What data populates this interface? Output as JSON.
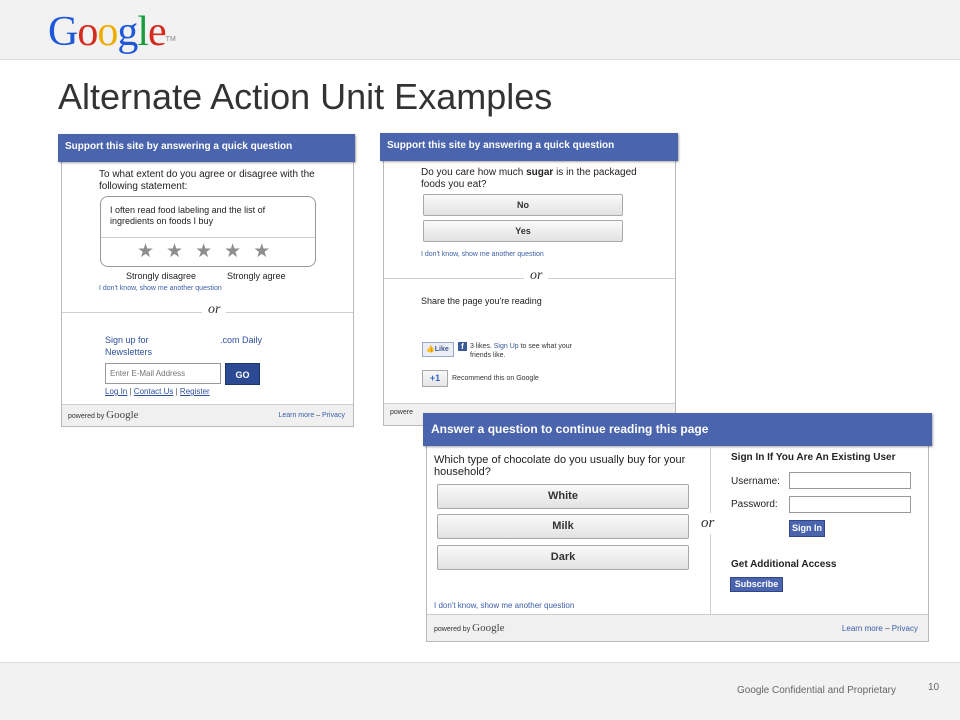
{
  "header": {
    "logo_letters": [
      {
        "char": "G",
        "color": "#1f59d8"
      },
      {
        "char": "o",
        "color": "#d62a1f"
      },
      {
        "char": "o",
        "color": "#f0ad00"
      },
      {
        "char": "g",
        "color": "#1f59d8"
      },
      {
        "char": "l",
        "color": "#189c3c"
      },
      {
        "char": "e",
        "color": "#d62a1f"
      }
    ],
    "logo_tm": "TM"
  },
  "slide": {
    "title": "Alternate Action Unit Examples"
  },
  "footer": {
    "confidential": "Google Confidential and Proprietary",
    "page_number": "10"
  },
  "unit_survey": {
    "header": "Support this site by answering a quick question",
    "question": "To what extent do you agree or disagree with the following statement:",
    "statement": "I often read food labeling and the list of ingredients on foods I buy",
    "star_count": 5,
    "label_low": "Strongly disagree",
    "label_high": "Strongly agree",
    "skip_link": "I don't know, show me another question",
    "or_text": "or",
    "newsletter_line1": "Sign up for",
    "newsletter_line1b": ".com Daily",
    "newsletter_line2": "Newsletters",
    "email_placeholder": "Enter E-Mail Address",
    "go_label": "GO",
    "link_login": "Log In",
    "link_contact": "Contact Us",
    "link_register": "Register",
    "link_sep": "|",
    "powered_by": "powered by",
    "brand": "Google",
    "learn_more": "Learn more",
    "privacy": "Privacy",
    "dash": "–"
  },
  "unit_social": {
    "header": "Support this site by answering a quick question",
    "question_pre": "Do you care how much ",
    "question_bold": "sugar",
    "question_post": " is in the packaged foods you eat?",
    "answers": [
      "No",
      "Yes"
    ],
    "skip_link": "I don't know, show me another question",
    "or_text": "or",
    "share_text": "Share the page you're reading",
    "like_label": "Like",
    "fb_text_pre": "3 likes. ",
    "fb_signup": "Sign Up",
    "fb_text_post": " to see what your friends like.",
    "plusone_label": "+1",
    "recommend_text": "Recommend this on Google",
    "powered_by_partial": "powere"
  },
  "unit_login": {
    "header": "Answer a question to continue reading this page",
    "question": "Which type of chocolate do you usually buy for your household?",
    "answers": [
      "White",
      "Milk",
      "Dark"
    ],
    "skip_link": "I don't know, show me another question",
    "or_text": "or",
    "signin_heading": "Sign In If You Are An Existing User",
    "username_label": "Username:",
    "password_label": "Password:",
    "signin_button": "Sign In",
    "access_heading": "Get Additional Access",
    "subscribe_button": "Subscribe",
    "powered_by": "powered by",
    "brand": "Google",
    "learn_more": "Learn more",
    "privacy": "Privacy",
    "dash": "–"
  }
}
